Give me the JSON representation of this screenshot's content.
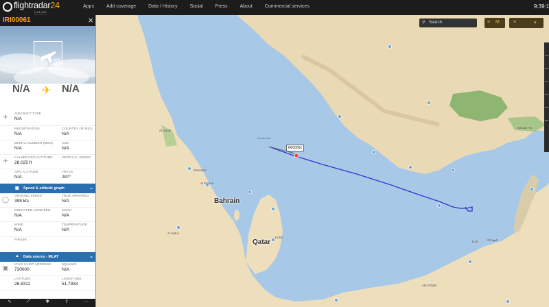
{
  "site": {
    "name_part1": "flightradar",
    "name_part2": "24",
    "tagline": "LIVE AIR TRAFFIC"
  },
  "nav": [
    "Apps",
    "Add coverage",
    "Data / History",
    "Social",
    "Press",
    "About",
    "Commercial services"
  ],
  "clock": "9:39:1",
  "search": {
    "placeholder": "Search"
  },
  "map_controls": {
    "menu_label": "M"
  },
  "flight": {
    "callsign": "IRI00061",
    "origin": "N/A",
    "destination": "N/A",
    "map_tag": "IRI00061"
  },
  "details": {
    "aircraft_type": {
      "label": "AIRCRAFT TYPE",
      "value": "N/A"
    },
    "registration": {
      "label": "REGISTRATION",
      "value": "N/A"
    },
    "country": {
      "label": "COUNTRY OF REG.",
      "value": "N/A"
    },
    "serial": {
      "label": "SERIAL NUMBER (MSN)",
      "value": "N/A"
    },
    "age": {
      "label": "AGE",
      "value": "N/A"
    },
    "cal_alt": {
      "label": "CALIBRATED ALTITUDE",
      "value": "28,025 ft"
    },
    "vert_speed": {
      "label": "VERTICAL SPEED",
      "value": ""
    },
    "gps_alt": {
      "label": "GPS ALTITUDE",
      "value": "N/A"
    },
    "track": {
      "label": "TRACK",
      "value": "287°"
    },
    "speed_section": "Speed & altitude graph",
    "ground_speed": {
      "label": "GROUND SPEED",
      "value": "398 kts"
    },
    "true_airspeed": {
      "label": "TRUE AIRSPEED",
      "value": "N/A"
    },
    "ind_airspeed": {
      "label": "INDICATED AIRSPEED",
      "value": "N/A"
    },
    "mach": {
      "label": "MACH",
      "value": "N/A"
    },
    "wind": {
      "label": "WIND",
      "value": "N/A"
    },
    "temperature": {
      "label": "TEMPERATURE",
      "value": "N/A"
    },
    "fir": {
      "label": "FIR/UIR",
      "value": ""
    },
    "data_section": "Data source - MLAT",
    "icao": {
      "label": "ICAO 24-BIT ADDRESS",
      "value": "730000"
    },
    "squawk": {
      "label": "SQUAWK",
      "value": "N/A"
    },
    "latitude": {
      "label": "LATITUDE",
      "value": "26.8311"
    },
    "longitude": {
      "label": "LONGITUDE",
      "value": "51.7933"
    }
  },
  "map_labels": {
    "bahrain": "Bahrain",
    "qatar": "Qatar",
    "dammam": "Dammam",
    "al_khobar": "Al Khobar",
    "doha": "Doha",
    "abu_dhabi": "Abu Dhabi",
    "dubai": "Dub",
    "sharjah": "Sharjah",
    "bandar": "Bandar Ab",
    "al_hufuf": "Al Hufuf",
    "al_jubail": "Al Jubail",
    "persian_gulf": "Persian Gulf"
  },
  "colors": {
    "accent": "#f7a900",
    "track": "#3333cc",
    "section": "#2a6fb0"
  }
}
